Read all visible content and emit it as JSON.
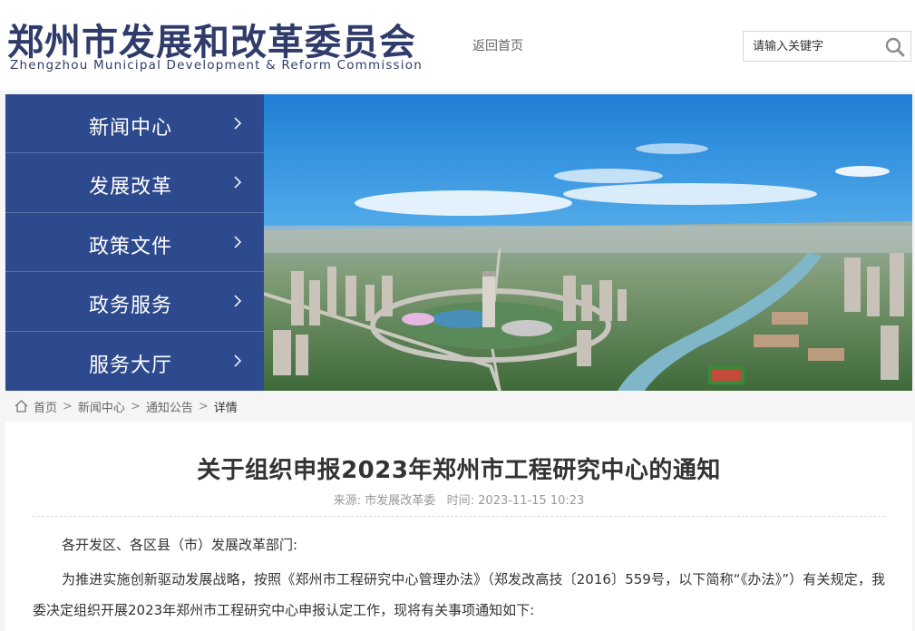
{
  "header": {
    "logo_cn": "郑州市发展和改革委员会",
    "logo_en": "Zhengzhou Municipal Development & Reform Commission",
    "home_link": "返回首页",
    "search_placeholder": "请输入关键字"
  },
  "nav": {
    "items": [
      {
        "label": "新闻中心"
      },
      {
        "label": "发展改革"
      },
      {
        "label": "政策文件"
      },
      {
        "label": "政务服务"
      },
      {
        "label": "服务大厅"
      }
    ]
  },
  "breadcrumb": {
    "items": [
      "首页",
      "新闻中心",
      "通知公告"
    ],
    "separator": ">",
    "current": "详情"
  },
  "article": {
    "title": "关于组织申报2023年郑州市工程研究中心的通知",
    "source_label": "来源:",
    "source": "市发展改革委",
    "time_label": "时间:",
    "time": "2023-11-15 10:23",
    "paragraphs": [
      "各开发区、各区县（市）发展改革部门:",
      "为推进实施创新驱动发展战略，按照《郑州市工程研究中心管理办法》（郑发改高技〔2016〕559号，以下简称“《办法》”）有关规定，我委决定组织开展2023年郑州市工程研究中心申报认定工作，现将有关事项通知如下:"
    ]
  },
  "colors": {
    "brand": "#2f3c6b",
    "nav_bg": "#2e4a8e",
    "page_bg": "#f5f5f5"
  },
  "icons": {
    "search": "search-icon",
    "home": "home-icon",
    "arrow": "chevron-right-icon"
  }
}
